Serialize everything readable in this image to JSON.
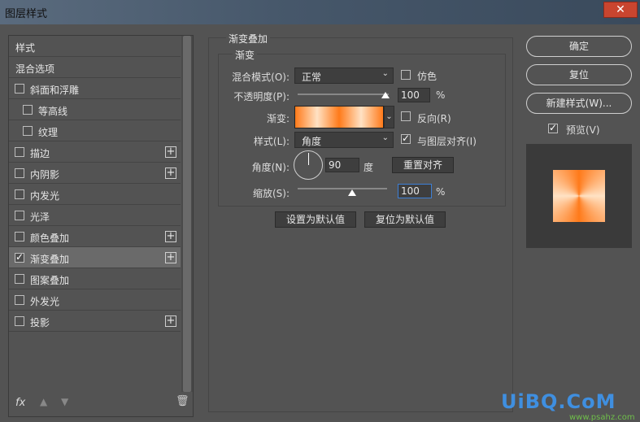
{
  "window": {
    "title": "图层样式",
    "close": "✕"
  },
  "styles_list": {
    "header": "样式",
    "blend_options": "混合选项",
    "items": [
      {
        "label": "斜面和浮雕",
        "checked": false,
        "sub": false,
        "plus": false
      },
      {
        "label": "等高线",
        "checked": false,
        "sub": true,
        "plus": false
      },
      {
        "label": "纹理",
        "checked": false,
        "sub": true,
        "plus": false
      },
      {
        "label": "描边",
        "checked": false,
        "sub": false,
        "plus": true
      },
      {
        "label": "内阴影",
        "checked": false,
        "sub": false,
        "plus": true
      },
      {
        "label": "内发光",
        "checked": false,
        "sub": false,
        "plus": false
      },
      {
        "label": "光泽",
        "checked": false,
        "sub": false,
        "plus": false
      },
      {
        "label": "颜色叠加",
        "checked": false,
        "sub": false,
        "plus": true
      },
      {
        "label": "渐变叠加",
        "checked": true,
        "sub": false,
        "plus": true,
        "selected": true
      },
      {
        "label": "图案叠加",
        "checked": false,
        "sub": false,
        "plus": false
      },
      {
        "label": "外发光",
        "checked": false,
        "sub": false,
        "plus": false
      },
      {
        "label": "投影",
        "checked": false,
        "sub": false,
        "plus": true
      }
    ],
    "fx_label": "fx",
    "plus_glyph": "+"
  },
  "gradient_overlay": {
    "group_title": "渐变叠加",
    "section_title": "渐变",
    "blend_mode_label": "混合模式(O):",
    "blend_mode_value": "正常",
    "dither_label": "仿色",
    "opacity_label": "不透明度(P):",
    "opacity_value": "100",
    "opacity_unit": "%",
    "gradient_label": "渐变:",
    "reverse_label": "反向(R)",
    "style_label": "样式(L):",
    "style_value": "角度",
    "align_label": "与图层对齐(I)",
    "angle_label": "角度(N):",
    "angle_value": "90",
    "angle_unit": "度",
    "reset_align_button": "重置对齐",
    "scale_label": "缩放(S):",
    "scale_value": "100",
    "scale_unit": "%",
    "set_default_button": "设置为默认值",
    "reset_default_button": "复位为默认值",
    "gradient_colors": [
      "#ff7a1a",
      "#ffe2c4"
    ]
  },
  "right_panel": {
    "ok_button": "确定",
    "reset_button": "复位",
    "new_style_button": "新建样式(W)...",
    "preview_label": "预览(V)"
  },
  "watermark": {
    "text": "UiBQ.CoM",
    "sub": "www.psahz.com"
  }
}
